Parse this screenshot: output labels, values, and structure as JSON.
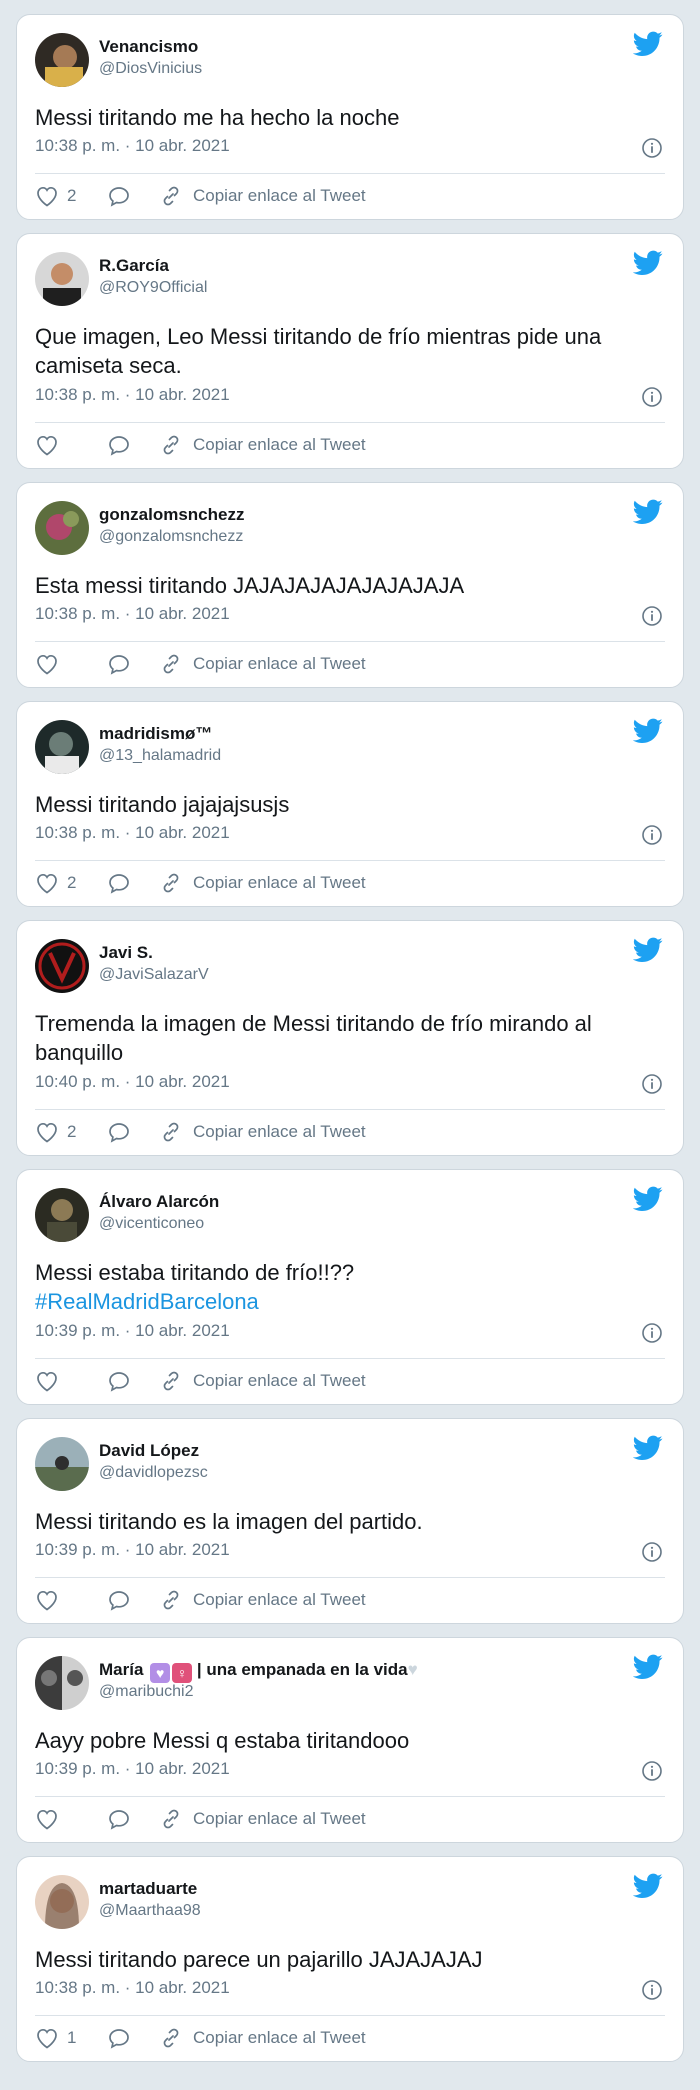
{
  "colors": {
    "background": "#e1e8ed",
    "card": "#ffffff",
    "text": "#14171a",
    "secondary": "#657786",
    "twitter_blue": "#1da1f2",
    "hashtag": "#1b95e0"
  },
  "icons": {
    "brand": "twitter-bird-icon",
    "info": "info-icon",
    "like": "heart-outline-icon",
    "reply": "speech-bubble-icon",
    "link": "chain-link-icon"
  },
  "tweets": [
    {
      "name": "Venancismo",
      "handle": "@DiosVinicius",
      "text": "Messi tiritando me ha hecho la noche",
      "timestamp": "10:38 p. m. · 10 abr. 2021",
      "likes": "2",
      "copy_link": "Copiar enlace al Tweet"
    },
    {
      "name": "R.García",
      "handle": "@ROY9Official",
      "text": "Que imagen, Leo Messi tiritando de frío mientras pide una camiseta seca.",
      "timestamp": "10:38 p. m. · 10 abr. 2021",
      "likes": "",
      "copy_link": "Copiar enlace al Tweet"
    },
    {
      "name": "gonzalomsnchezz",
      "handle": "@gonzalomsnchezz",
      "text": "Esta messi tiritando JAJAJAJAJAJAJAJAJA",
      "timestamp": "10:38 p. m. · 10 abr. 2021",
      "likes": "",
      "copy_link": "Copiar enlace al Tweet"
    },
    {
      "name": "madridismø™",
      "handle": "@13_halamadrid",
      "text": "Messi tiritando jajajajsusjs",
      "timestamp": "10:38 p. m. · 10 abr. 2021",
      "likes": "2",
      "copy_link": "Copiar enlace al Tweet"
    },
    {
      "name": "Javi S.",
      "handle": "@JaviSalazarV",
      "text": "Tremenda la imagen de Messi tiritando de frío mirando al banquillo",
      "timestamp": "10:40 p. m. · 10 abr. 2021",
      "likes": "2",
      "copy_link": "Copiar enlace al Tweet"
    },
    {
      "name": "Álvaro Alarcón",
      "handle": "@vicenticoneo",
      "text": "Messi estaba tiritando de  frío!!??",
      "hashtag": "#RealMadridBarcelona",
      "timestamp": "10:39 p. m. · 10 abr. 2021",
      "likes": "",
      "copy_link": "Copiar enlace al Tweet"
    },
    {
      "name": "David López",
      "handle": "@davidlopezsc",
      "text": "Messi tiritando es la imagen del partido.",
      "timestamp": "10:39 p. m. · 10 abr. 2021",
      "likes": "",
      "copy_link": "Copiar enlace al Tweet"
    },
    {
      "name": "María",
      "name_suffix": "| una empanada en la vida",
      "handle": "@maribuchi2",
      "text": "Aayy pobre Messi q estaba tiritandooo",
      "timestamp": "10:39 p. m. · 10 abr. 2021",
      "likes": "",
      "copy_link": "Copiar enlace al Tweet"
    },
    {
      "name": "martaduarte",
      "handle": "@Maarthaa98",
      "text": "Messi tiritando parece un pajarillo JAJAJAJAJ",
      "timestamp": "10:38 p. m. · 10 abr. 2021",
      "likes": "1",
      "copy_link": "Copiar enlace al Tweet"
    }
  ]
}
